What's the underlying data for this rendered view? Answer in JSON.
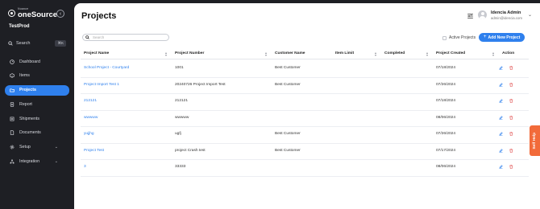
{
  "brand": {
    "small": "Nuance",
    "name": "oneSource"
  },
  "sidebar": {
    "org": "TestProd",
    "search_label": "Search",
    "search_shortcut": "⌘K",
    "items": [
      {
        "label": "Dashboard",
        "icon": "dashboard-icon"
      },
      {
        "label": "Items",
        "icon": "items-icon"
      },
      {
        "label": "Projects",
        "icon": "projects-icon",
        "active": true
      },
      {
        "label": "Report",
        "icon": "report-icon"
      },
      {
        "label": "Shipments",
        "icon": "shipments-icon"
      },
      {
        "label": "Documents",
        "icon": "documents-icon"
      },
      {
        "label": "Setup",
        "icon": "gear-icon",
        "expandable": true
      },
      {
        "label": "Integration",
        "icon": "integration-icon",
        "expandable": true
      }
    ]
  },
  "header": {
    "title": "Projects",
    "user_name": "Idencia Admin",
    "user_email": "admin@idencia.com"
  },
  "toolbar": {
    "search_placeholder": "Search",
    "active_label": "Active Projects",
    "add_label": "Add New Project"
  },
  "table": {
    "columns": [
      "Project Name",
      "Project Number",
      "Customer Name",
      "Item Limit",
      "Completed",
      "Project Created",
      "Action"
    ],
    "rows": [
      {
        "name": "School Project - Courtyard",
        "number": "1001",
        "customer": "Best Customer",
        "limit": "",
        "completed": "",
        "created": "07/18/2024"
      },
      {
        "name": "Project Import Test 1",
        "number": "20240726 Project Import Test",
        "customer": "Best Customer",
        "limit": "",
        "completed": "",
        "created": "07/26/2024"
      },
      {
        "name": "212121",
        "number": "212121",
        "customer": "",
        "limit": "",
        "completed": "",
        "created": "07/18/2024"
      },
      {
        "name": "wwwww",
        "number": "wwwww",
        "customer": "",
        "limit": "",
        "completed": "",
        "created": "08/06/2024"
      },
      {
        "name": "yujjhg",
        "number": "ugfj",
        "customer": "Best Customer",
        "limit": "",
        "completed": "",
        "created": "07/26/2024"
      },
      {
        "name": "Project Test",
        "number": "project Crash test",
        "customer": "Best Customer",
        "limit": "",
        "completed": "",
        "created": "07/17/2024"
      },
      {
        "name": "3",
        "number": "33333",
        "customer": "",
        "limit": "",
        "completed": "",
        "created": "08/06/2024"
      }
    ]
  },
  "self_help": "Self Help",
  "colors": {
    "accent": "#2f80ed",
    "sidebar": "#1e1f24",
    "danger": "#e04b4b",
    "self_help": "#f26b3a"
  }
}
